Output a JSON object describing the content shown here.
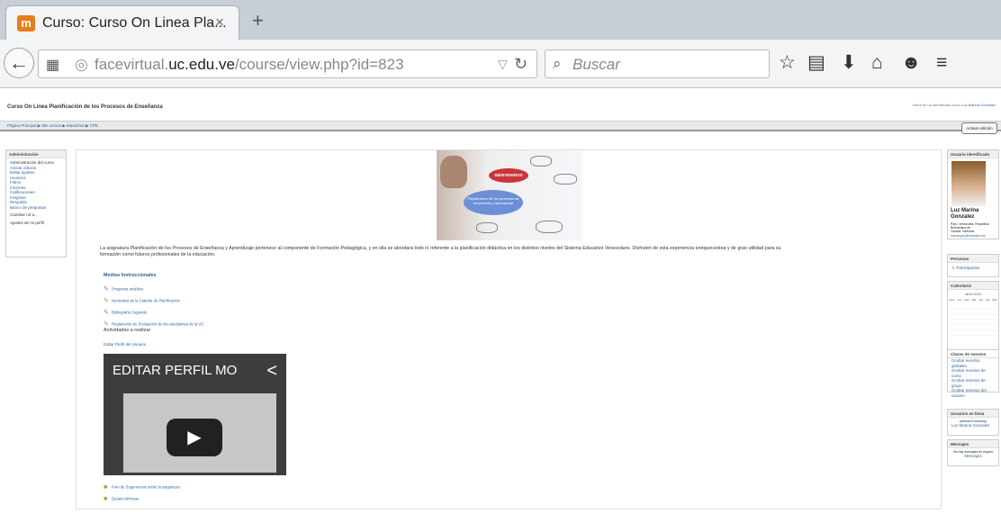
{
  "browser": {
    "tab_title": "Curso: Curso On Linea Pla...",
    "tab_close": "×",
    "new_tab": "+",
    "favicon_text": "m",
    "url_prefix": "facevirtual.",
    "url_domain": "uc.edu.ve",
    "url_path": "/course/view.php?id=823",
    "search_placeholder": "Buscar"
  },
  "page": {
    "header_title": "Curso On Linea Planificación de los Procesos de Enseñanza",
    "login_text": "Usted se ha identificado como",
    "login_user": "Luz Marina Gonzalez",
    "breadcrumb": "Página Principal ▶ Mis cursos ▶ Maestrías ▶ CPE",
    "edit_button": "Activar edición"
  },
  "admin_block": {
    "title": "Administración",
    "items": [
      "Administración del curso",
      "Activar edición",
      "Editar ajustes",
      "Usuarios",
      "Filtros",
      "Informes",
      "Calificaciones",
      "Insignias",
      "Respaldo",
      "Banco de preguntas",
      "Cambiar rol a...",
      "Ajustes de mi perfil"
    ]
  },
  "banner": {
    "bubble": "BIENVENIDOS",
    "center": "Planificación de los procesos de enseñanza y aprendizaje"
  },
  "content": {
    "intro": "La asignatura Planificación de los Procesos de Enseñanza y Aprendizaje pertenece al componente de Formación Pedagógica, y en ella se abordará todo lo referente a la planificación didáctica en los distintos niveles del Sistema Educativo Venezolano. Disfruten de esta experiencia enriquecedora y de gran utilidad para su formación como futuros profesionales de la educación.",
    "section1": "Medios Instruccionales",
    "resources": [
      "Programa analítico",
      "Normativa de la Cátedra de Planificación",
      "Bibliografía Sugerida",
      "Reglamento de Evaluación de los estudiantes de la UC"
    ],
    "section2": "Actividades a realizar",
    "activity1": "Editar Perfil del Usuario",
    "video_title": "EDITAR PERFIL MO",
    "forum": "Foro de Sugerencias sobre la asignatura",
    "quiz": "Dudas Idénticas"
  },
  "right": {
    "user_block_title": "Usuario identificado",
    "user_name": "Luz Marina Gonzalez",
    "user_info": "País: Venezuela, República Bolivariana de",
    "user_city": "Ciudad: Valencia",
    "user_email": "luzmargon@hotmail.com",
    "people_title": "Personas",
    "participants": "Participantes",
    "calendar_title": "Calendario",
    "calendar_month": "abril 2016",
    "calendar_days": [
      "Dom",
      "Lun",
      "Mar",
      "Mié",
      "Jue",
      "Vie",
      "Sáb"
    ],
    "events_title": "Claves de eventos",
    "events": [
      "Ocultar eventos globales",
      "Ocultar eventos de curso",
      "Ocultar eventos de grupo",
      "Ocultar eventos del usuario"
    ],
    "online_title": "Usuarios en línea",
    "online_sub": "(últimos 5 minutos)",
    "online_user": "Luz Marina Gonzalez",
    "messages_title": "Mensajes",
    "messages_text": "No hay mensajes en espera",
    "messages_link": "Mensajes"
  }
}
